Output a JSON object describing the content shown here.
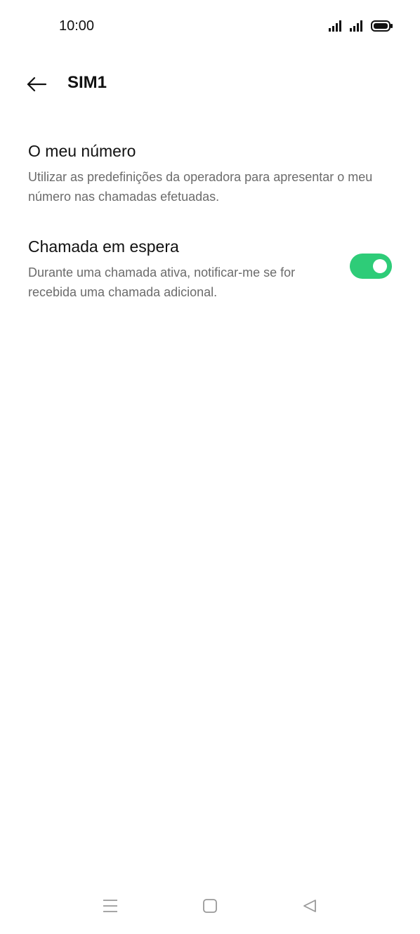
{
  "status_bar": {
    "time": "10:00",
    "icons": [
      "signal-icon",
      "signal-icon",
      "battery-icon"
    ]
  },
  "header": {
    "title": "SIM1",
    "back_icon": "back-arrow-icon"
  },
  "settings": [
    {
      "title": "O meu número",
      "description": "Utilizar as predefinições da operadora para apresentar o meu número nas chamadas efetuadas."
    },
    {
      "title": "Chamada em espera",
      "description": "Durante uma chamada ativa, notificar-me se for recebida uma chamada adicional.",
      "toggle_on": true
    }
  ],
  "nav_bar": {
    "icons": [
      "menu-icon",
      "home-icon",
      "back-triangle-icon"
    ]
  },
  "colors": {
    "toggle_on": "#2ecc78",
    "description_text": "#6b6b6b"
  }
}
